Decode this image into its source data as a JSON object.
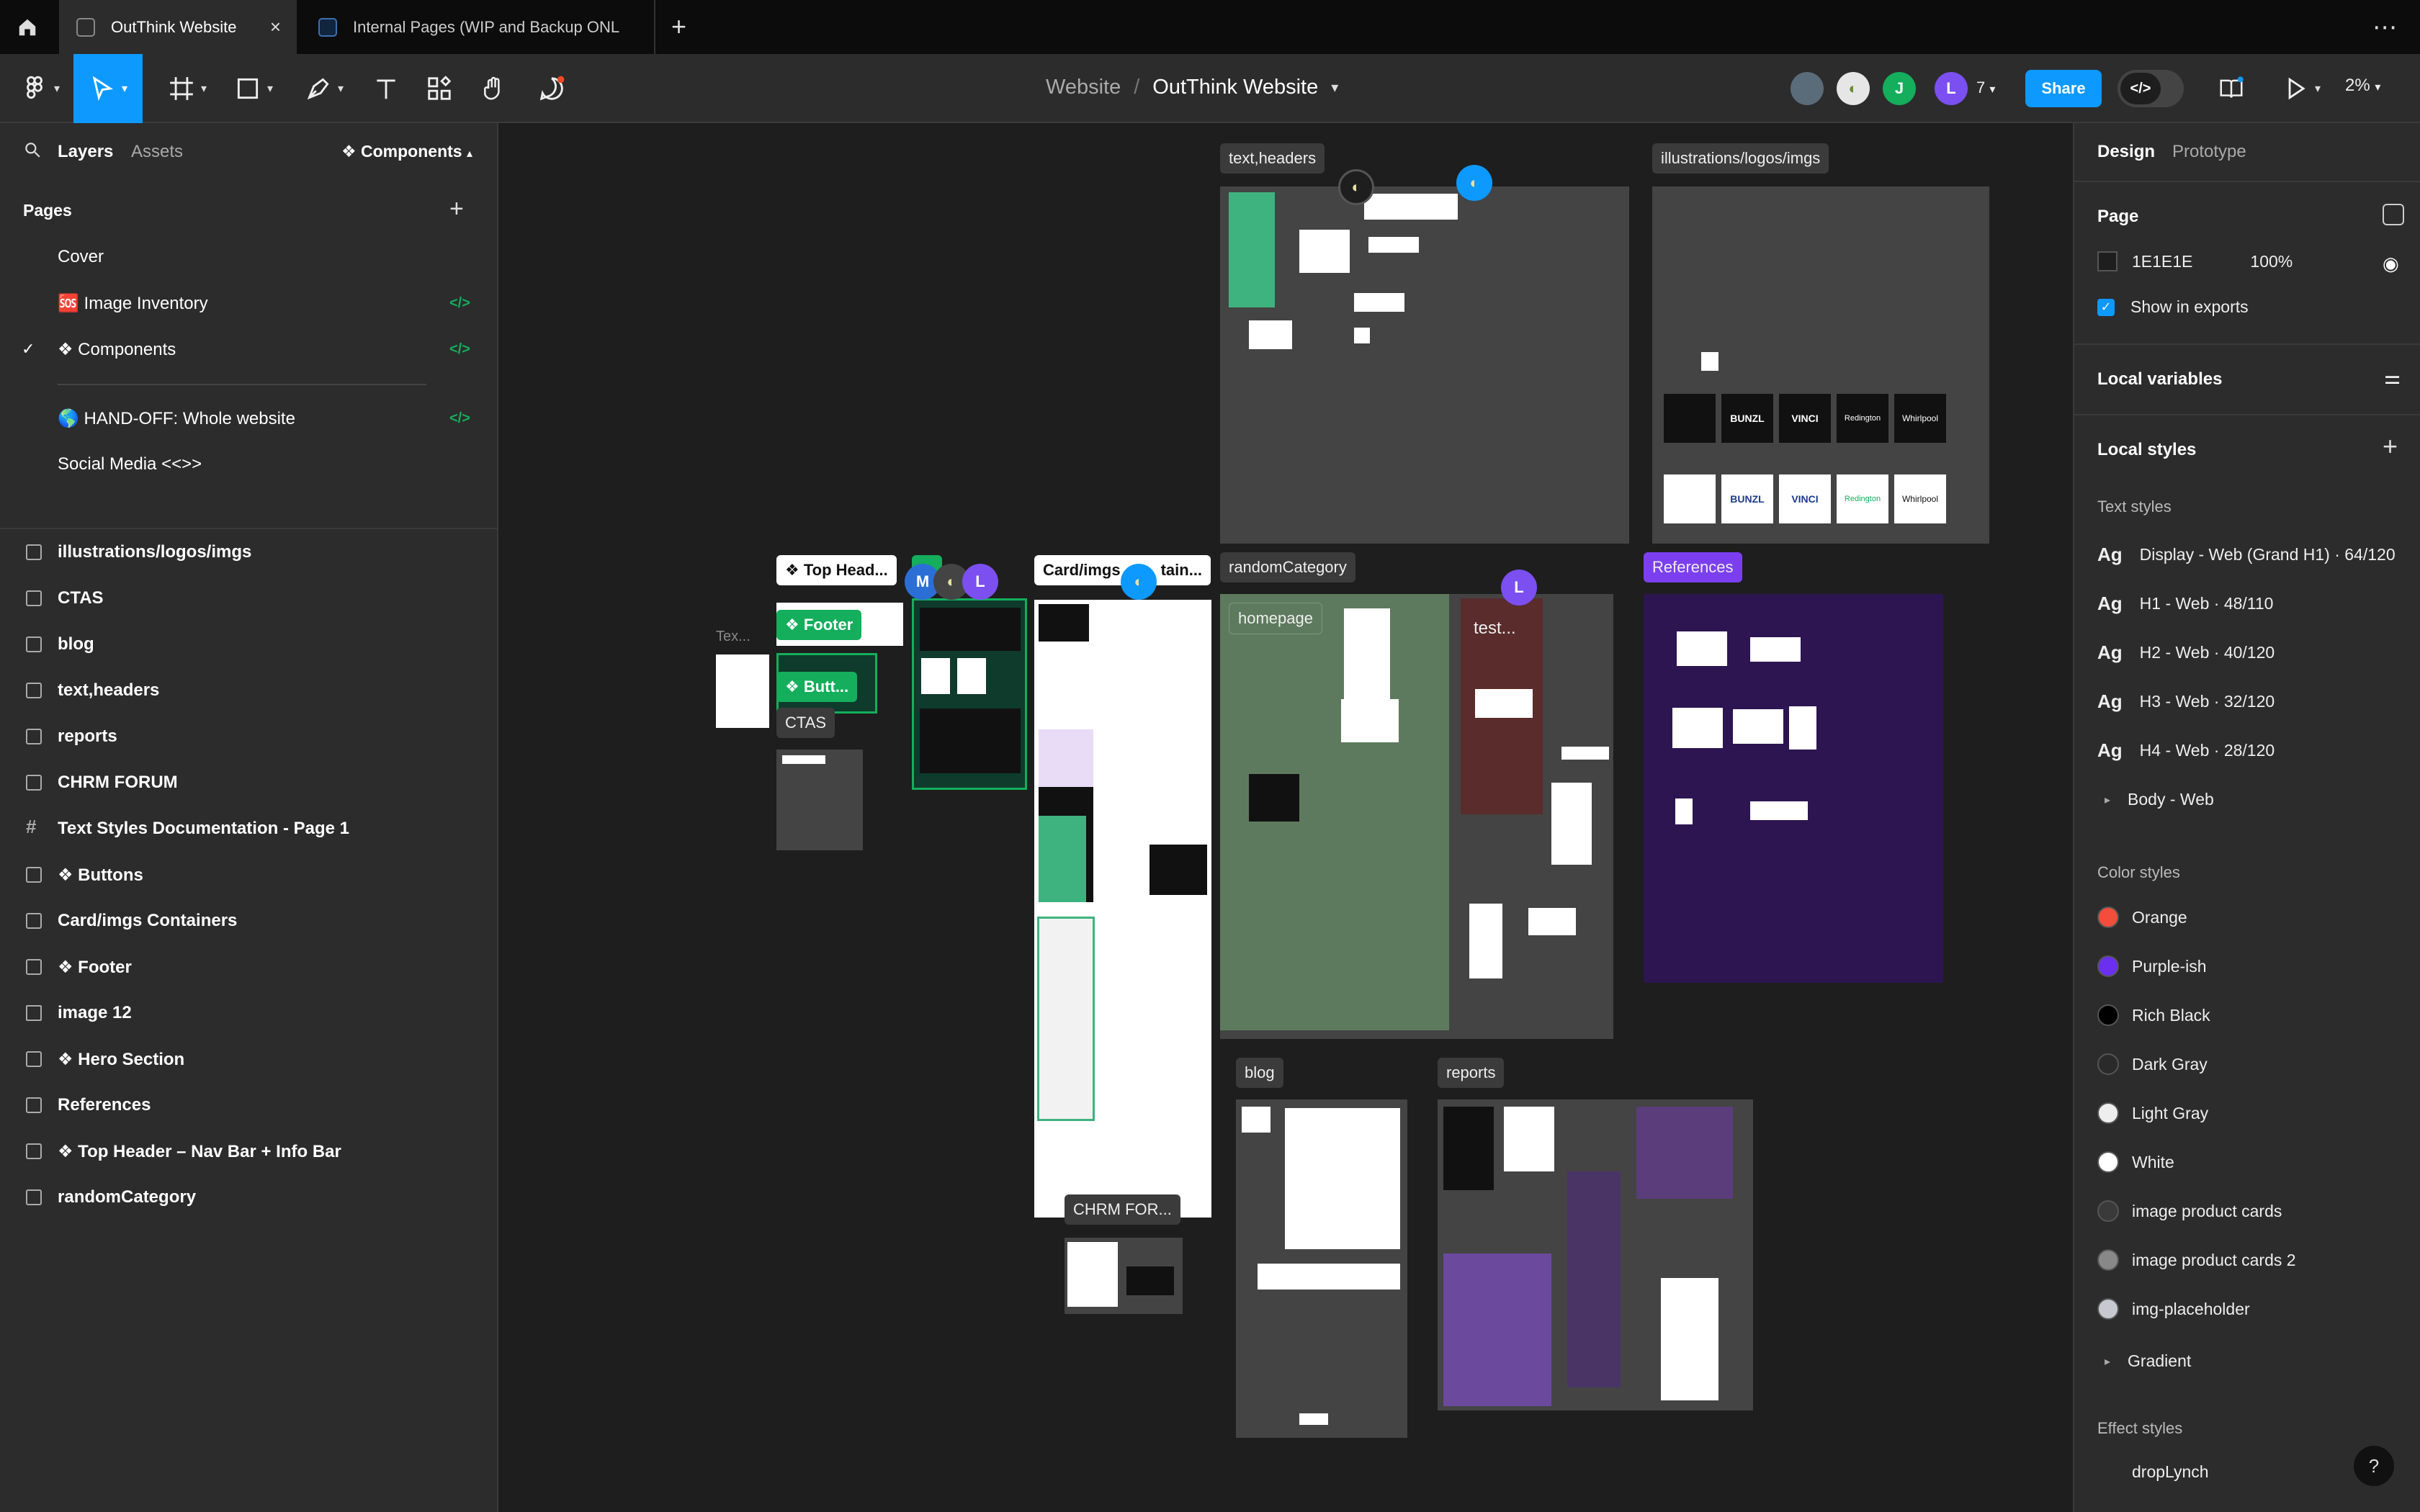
{
  "tabs": [
    {
      "label": "OutThink Website"
    },
    {
      "label": "Internal Pages (WIP and Backup ONL"
    }
  ],
  "toolbar": {
    "breadcrumb_project": "Website",
    "breadcrumb_sep": "/",
    "breadcrumb_file": "OutThink Website",
    "avatars": [
      "",
      "",
      "J",
      "L"
    ],
    "collaborator_count": "7",
    "share_label": "Share",
    "zoom": "2%"
  },
  "left_panel": {
    "layers_tab": "Layers",
    "assets_tab": "Assets",
    "current_page": "❖ Components",
    "pages_title": "Pages",
    "pages": [
      {
        "label": "Cover",
        "current": false,
        "dev": false
      },
      {
        "label": "🆘 Image Inventory",
        "current": false,
        "dev": true
      },
      {
        "label": "❖ Components",
        "current": true,
        "dev": true
      },
      {
        "label": "🌎 HAND-OFF: Whole website",
        "current": false,
        "dev": true
      },
      {
        "label": "Social Media <<>>",
        "current": false,
        "dev": false
      }
    ],
    "layers": [
      {
        "label": "illustrations/logos/imgs",
        "icon": "section"
      },
      {
        "label": "CTAS",
        "icon": "section"
      },
      {
        "label": "blog",
        "icon": "section"
      },
      {
        "label": "text,headers",
        "icon": "section"
      },
      {
        "label": "reports",
        "icon": "section"
      },
      {
        "label": "CHRM FORUM",
        "icon": "section"
      },
      {
        "label": "Text Styles Documentation - Page 1",
        "icon": "frame"
      },
      {
        "label": "❖ Buttons",
        "icon": "section"
      },
      {
        "label": "Card/imgs Containers",
        "icon": "section"
      },
      {
        "label": "❖ Footer",
        "icon": "section"
      },
      {
        "label": "image 12",
        "icon": "image"
      },
      {
        "label": "❖ Hero Section",
        "icon": "section"
      },
      {
        "label": "References",
        "icon": "section"
      },
      {
        "label": "❖ Top Header – Nav Bar + Info Bar",
        "icon": "section"
      },
      {
        "label": "randomCategory",
        "icon": "section"
      }
    ]
  },
  "canvas": {
    "labels": {
      "text_headers": "text,headers",
      "illustrations": "illustrations/logos/imgs",
      "top_head": "❖ Top Head...",
      "footer": "❖ Footer",
      "butt": "❖ Butt...",
      "ctas": "CTAS",
      "tex": "Tex...",
      "card_imgs": "Card/imgs",
      "card_tail": "tain...",
      "random_category": "randomCategory",
      "homepage": "homepage",
      "test": "test...",
      "references": "References",
      "chrm": "CHRM FOR...",
      "blog": "blog",
      "reports": "reports",
      "hero_fragment": "..."
    },
    "cursors": [
      "M",
      "L",
      "L"
    ],
    "logos": [
      "",
      "BUNZL",
      "VINCI",
      "Redington",
      "Whirlpool"
    ]
  },
  "right_panel": {
    "design_tab": "Design",
    "prototype_tab": "Prototype",
    "page_title": "Page",
    "page_color": "1E1E1E",
    "page_opacity": "100%",
    "show_in_exports": "Show in exports",
    "local_variables": "Local variables",
    "local_styles": "Local styles",
    "text_styles_title": "Text styles",
    "ag": "Ag",
    "text_styles": [
      "Display - Web (Grand H1) · 64/120",
      "H1 - Web · 48/110",
      "H2 - Web · 40/120",
      "H3 - Web · 32/120",
      "H4 - Web · 28/120"
    ],
    "body_group": "Body - Web",
    "color_styles_title": "Color styles",
    "color_styles": [
      {
        "name": "Orange",
        "color": "#f24e3b"
      },
      {
        "name": "Purple-ish",
        "color": "#6b2ff0"
      },
      {
        "name": "Rich Black",
        "color": "#000000"
      },
      {
        "name": "Dark Gray",
        "color": "#2a2a2a"
      },
      {
        "name": "Light Gray",
        "color": "#eeeeee"
      },
      {
        "name": "White",
        "color": "#ffffff"
      },
      {
        "name": "image product cards",
        "color": "#3a3a3a"
      },
      {
        "name": "image product cards 2",
        "color": "#888888"
      },
      {
        "name": "img-placeholder",
        "color": "#c8c8d0"
      }
    ],
    "gradient_group": "Gradient",
    "effect_styles_title": "Effect styles",
    "effect_styles": [
      "dropLynch"
    ]
  },
  "help": "?"
}
